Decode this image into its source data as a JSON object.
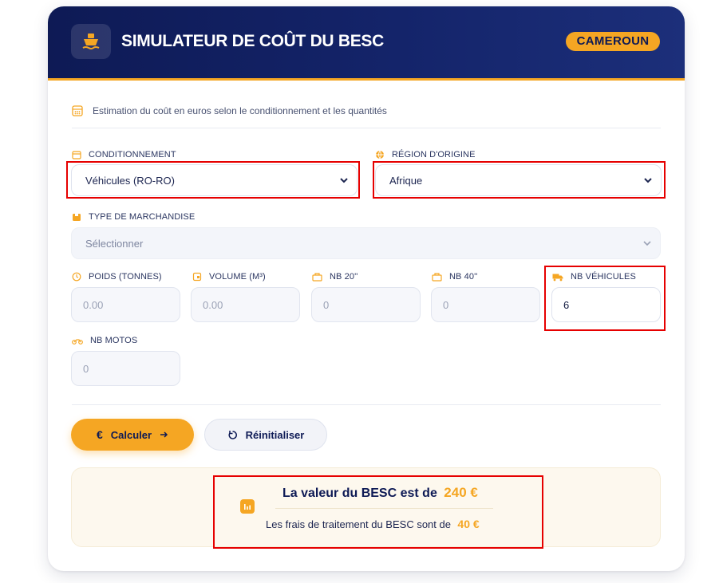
{
  "header": {
    "title": "SIMULATEUR DE COÛT DU BESC",
    "country": "CAMEROUN",
    "icon": "ship-icon"
  },
  "intro": {
    "text": "Estimation du coût en euros selon le conditionnement et les quantités",
    "icon": "calculator-icon"
  },
  "fields": {
    "conditionnement": {
      "label": "CONDITIONNEMENT",
      "value": "Véhicules (RO-RO)",
      "icon": "box-icon"
    },
    "region": {
      "label": "RÉGION D'ORIGINE",
      "value": "Afrique",
      "icon": "globe-icon"
    },
    "type_marchandise": {
      "label": "TYPE DE MARCHANDISE",
      "placeholder": "Sélectionner",
      "icon": "package-icon"
    },
    "poids": {
      "label": "POIDS (TONNES)",
      "value": "0.00",
      "icon": "weight-icon"
    },
    "volume": {
      "label": "VOLUME (M³)",
      "value": "0.00",
      "icon": "cube-icon"
    },
    "nb20": {
      "label": "NB 20''",
      "value": "0",
      "icon": "container-icon"
    },
    "nb40": {
      "label": "NB 40''",
      "value": "0",
      "icon": "container-icon"
    },
    "nb_vehicules": {
      "label": "NB VÉHICULES",
      "value": "6",
      "icon": "truck-icon"
    },
    "nb_motos": {
      "label": "NB MOTOS",
      "value": "0",
      "icon": "motorcycle-icon"
    }
  },
  "buttons": {
    "calculate": "Calculer",
    "reset": "Réinitialiser"
  },
  "result": {
    "value_prefix": "La valeur du BESC est de",
    "value_amount": "240 €",
    "fee_prefix": "Les frais de traitement du BESC sont de",
    "fee_amount": "40 €",
    "icon": "chart-icon"
  },
  "colors": {
    "navy": "#0e1a55",
    "accent": "#f5a623",
    "highlight": "#e60000"
  }
}
